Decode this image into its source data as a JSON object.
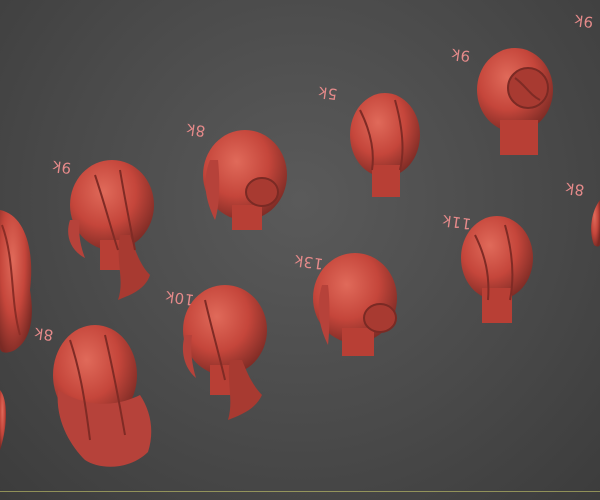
{
  "viewport": {
    "labels": [
      "9k",
      "8k",
      "5k",
      "9k",
      "8k",
      "13k",
      "11k",
      "10k",
      "8k",
      "9k"
    ],
    "hair_color": "#c9483e",
    "background_color": "#4b4b4b"
  }
}
